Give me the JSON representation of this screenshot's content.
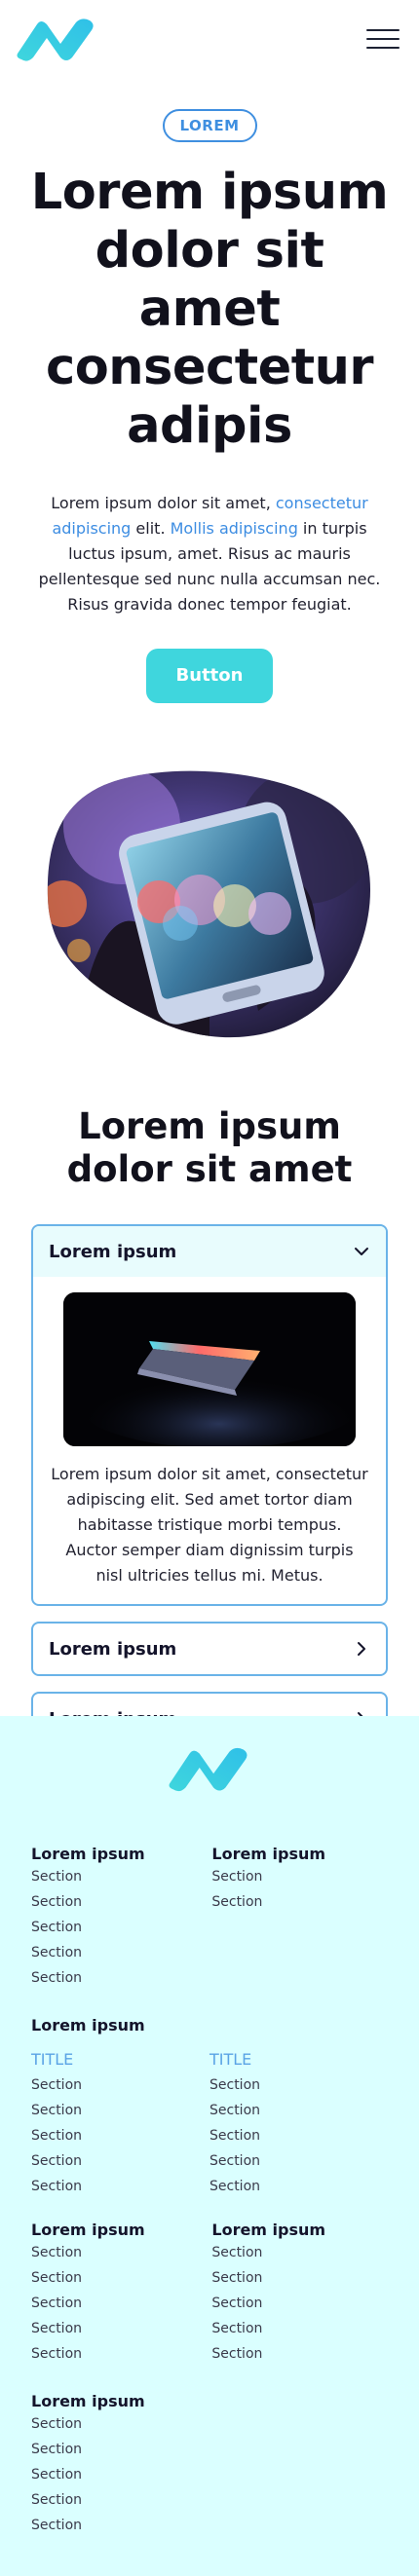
{
  "header": {
    "logo_icon": "logo-n-mark",
    "menu_icon": "hamburger-icon"
  },
  "hero": {
    "badge": "LOREM",
    "title": "Lorem ipsum dolor sit amet consectetur adipis",
    "para_a": "Lorem ipsum dolor sit amet, ",
    "para_link1": "consectetur adipiscing",
    "para_b": " elit. ",
    "para_link2": "Mollis adipiscing",
    "para_c": " in turpis luctus ipsum, amet. Risus ac mauris pellentesque sed nunc nulla accumsan nec. Risus gravida donec tempor feugiat.",
    "button": "Button"
  },
  "section2": {
    "title": "Lorem ipsum dolor sit amet",
    "accordion": [
      {
        "title": "Lorem ipsum",
        "expanded": true,
        "body": "Lorem ipsum dolor sit amet, consectetur adipiscing elit. Sed amet tortor diam habitasse tristique morbi tempus. Auctor semper diam dignissim turpis nisl ultricies tellus mi. Metus."
      },
      {
        "title": "Lorem ipsum",
        "expanded": false
      },
      {
        "title": "Lorem ipsum",
        "expanded": false
      }
    ]
  },
  "footer": {
    "group1": {
      "left": {
        "heading": "Lorem ipsum",
        "links": [
          "Section",
          "Section",
          "Section",
          "Section",
          "Section"
        ]
      },
      "right": {
        "heading": "Lorem ipsum",
        "links": [
          "Section",
          "Section"
        ]
      }
    },
    "group2": {
      "heading": "Lorem ipsum",
      "left": {
        "title": "TITLE",
        "links": [
          "Section",
          "Section",
          "Section",
          "Section",
          "Section"
        ]
      },
      "right": {
        "title": "TITLE",
        "links": [
          "Section",
          "Section",
          "Section",
          "Section",
          "Section"
        ]
      }
    },
    "group3": {
      "left": {
        "heading": "Lorem ipsum",
        "links": [
          "Section",
          "Section",
          "Section",
          "Section",
          "Section"
        ]
      },
      "right": {
        "heading": "Lorem ipsum",
        "links": [
          "Section",
          "Section",
          "Section",
          "Section",
          "Section"
        ]
      }
    },
    "group4": {
      "heading": "Lorem ipsum",
      "links": [
        "Section",
        "Section",
        "Section",
        "Section",
        "Section"
      ]
    }
  },
  "colors": {
    "accent": "#3fd6dd",
    "link": "#3d8de2",
    "border": "#6ab3e8",
    "footer_bg": "#daffff"
  }
}
